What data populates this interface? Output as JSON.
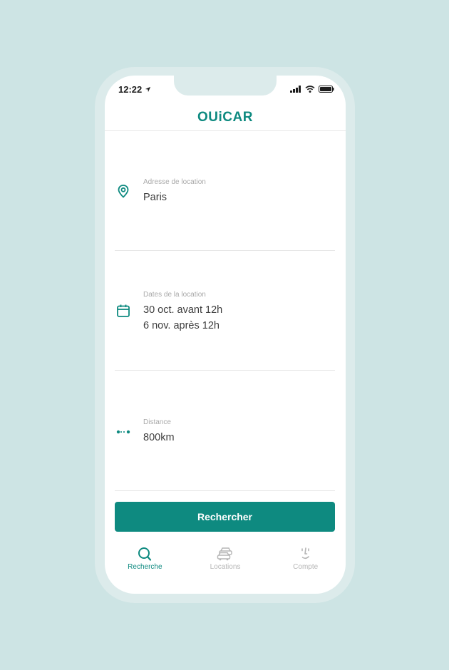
{
  "status_bar": {
    "time": "12:22"
  },
  "header": {
    "logo": "OUiCAR"
  },
  "fields": {
    "address": {
      "label": "Adresse de location",
      "value": "Paris",
      "icon": "map-pin-icon"
    },
    "dates": {
      "label": "Dates de la location",
      "start": "30 oct. avant 12h",
      "end": "6 nov. après 12h",
      "icon": "calendar-icon"
    },
    "distance": {
      "label": "Distance",
      "value": "800km",
      "icon": "distance-icon"
    }
  },
  "search_button": {
    "label": "Rechercher"
  },
  "tabbar": {
    "tabs": [
      {
        "label": "Recherche",
        "icon": "search-icon",
        "active": true
      },
      {
        "label": "Locations",
        "icon": "cars-icon",
        "active": false
      },
      {
        "label": "Compte",
        "icon": "face-icon",
        "active": false
      }
    ]
  },
  "colors": {
    "brand": "#0e8a80",
    "background": "#cde4e4",
    "inactive": "#b5b5b5"
  }
}
